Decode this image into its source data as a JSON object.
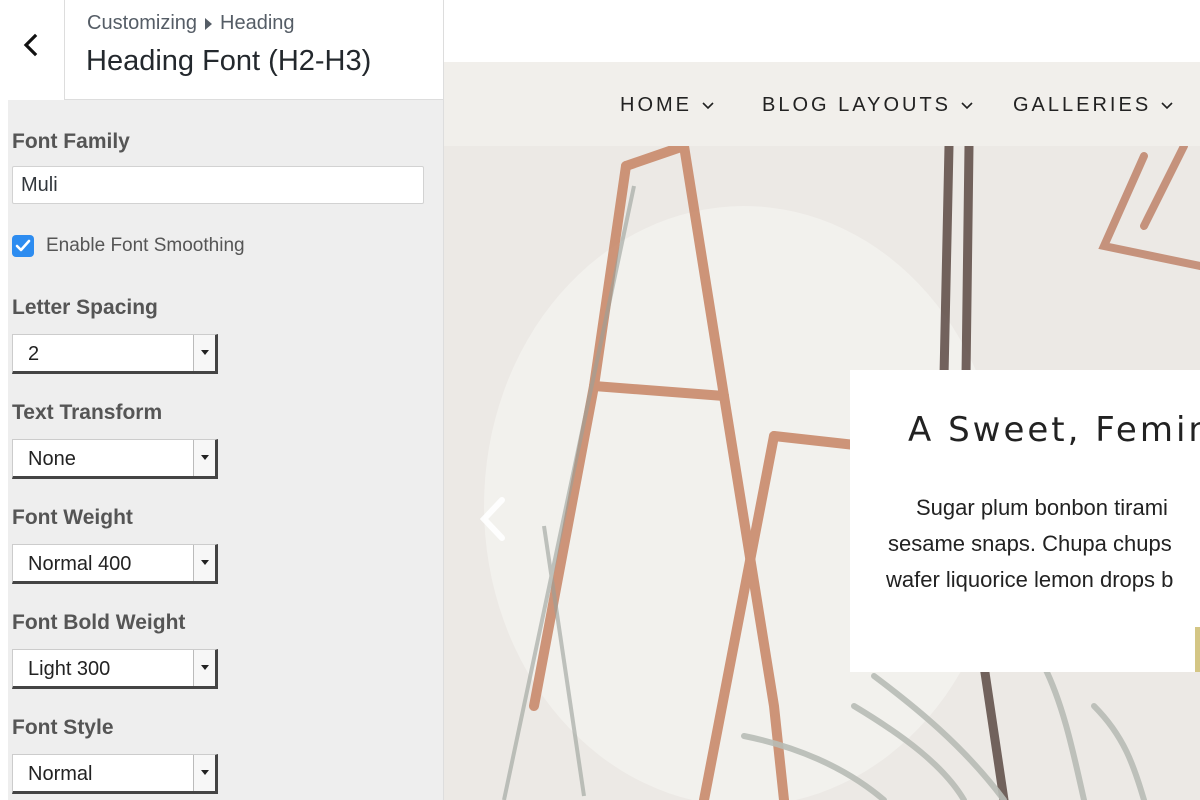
{
  "customizer": {
    "breadcrumb_root": "Customizing",
    "breadcrumb_section": "Heading",
    "title": "Heading Font (H2-H3)",
    "controls": {
      "font_family_label": "Font Family",
      "font_family_value": "Muli",
      "font_smoothing_label": "Enable Font Smoothing",
      "font_smoothing_checked": true,
      "letter_spacing_label": "Letter Spacing",
      "letter_spacing_value": "2",
      "text_transform_label": "Text Transform",
      "text_transform_value": "None",
      "font_weight_label": "Font Weight",
      "font_weight_value": "Normal 400",
      "font_bold_weight_label": "Font Bold Weight",
      "font_bold_weight_value": "Light 300",
      "font_style_label": "Font Style",
      "font_style_value": "Normal"
    },
    "icons": {
      "back": "chevron-left-icon",
      "checkbox": "checkmark-icon",
      "select_arrow": "triangle-down-icon"
    }
  },
  "preview": {
    "nav": [
      "HOME",
      "BLOG LAYOUTS",
      "GALLERIES"
    ],
    "slide": {
      "title": "A Sweet, Femin",
      "text_lines": [
        "Sugar plum bonbon tirami",
        "sesame snaps. Chupa chups",
        "wafer liquorice lemon drops b"
      ]
    },
    "colors": {
      "nav_bg": "#f1efeb",
      "accent_button": "#d4c685",
      "checkbox": "#2d8cf0",
      "copper": "#c98a6c"
    }
  }
}
